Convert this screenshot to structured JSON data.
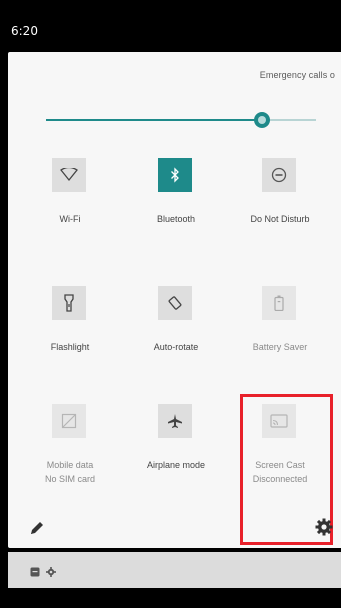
{
  "status_bar": {
    "time": "6:20"
  },
  "header": {
    "carrier_text": "Emergency calls o"
  },
  "brightness": {
    "level": 0.82
  },
  "tiles": [
    {
      "label": "Wi-Fi",
      "icon": "wifi-icon",
      "active": false
    },
    {
      "label": "Bluetooth",
      "icon": "bluetooth-icon",
      "active": true
    },
    {
      "label": "Do Not Disturb",
      "icon": "do-not-disturb-icon",
      "active": false
    },
    {
      "label": "Flashlight",
      "icon": "flashlight-icon",
      "active": false
    },
    {
      "label": "Auto-rotate",
      "icon": "auto-rotate-icon",
      "active": false
    },
    {
      "label": "Battery Saver",
      "icon": "battery-saver-icon",
      "active": false
    },
    {
      "label": "Mobile data",
      "sublabel": "No SIM card",
      "icon": "mobile-data-icon",
      "active": false
    },
    {
      "label": "Airplane mode",
      "icon": "airplane-icon",
      "active": false
    },
    {
      "label": "Screen Cast",
      "sublabel": "Disconnected",
      "icon": "cast-icon",
      "active": false
    }
  ],
  "footer": {
    "edit_icon": "pencil-icon",
    "settings_icon": "gear-icon"
  },
  "colors": {
    "accent": "#1e8a8a",
    "highlight": "#e8202a",
    "panel": "#f7f7f7"
  }
}
